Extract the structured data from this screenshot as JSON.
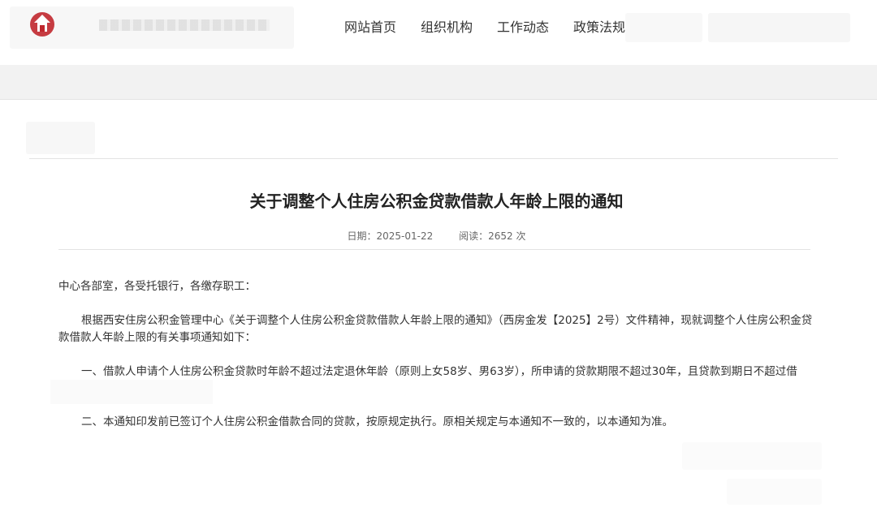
{
  "header": {
    "logo_icon": "emblem-icon",
    "nav": [
      {
        "label": "网站首页"
      },
      {
        "label": "组织机构"
      },
      {
        "label": "工作动态"
      },
      {
        "label": "政策法规"
      }
    ]
  },
  "article": {
    "title": "关于调整个人住房公积金贷款借款人年龄上限的通知",
    "date_label": "日期：",
    "date": "2025-01-22",
    "reads_label": "阅读：",
    "reads": "2652",
    "reads_unit": "次",
    "salutation": "中心各部室，各受托银行，各缴存职工：",
    "intro": "根据西安住房公积金管理中心《关于调整个人住房公积金贷款借款人年龄上限的通知》（西房金发【2025】2号）文件精神，现就调整个人住房公积金贷款借款人年龄上限的有关事项通知如下：",
    "item1": "一、借款人申请个人住房公积金贷款时年龄不超过法定退休年龄（原则上女58岁、男63岁），所申请的贷款期限不超过30年，且贷款到期日不超过借",
    "item2": "二、本通知印发前已签订个人住房公积金借款合同的贷款，按原规定执行。原相关规定与本通知不一致的，以本通知为准。"
  },
  "colors": {
    "accent": "#c0272d",
    "text": "#333333",
    "rule": "#e3e3e3"
  }
}
